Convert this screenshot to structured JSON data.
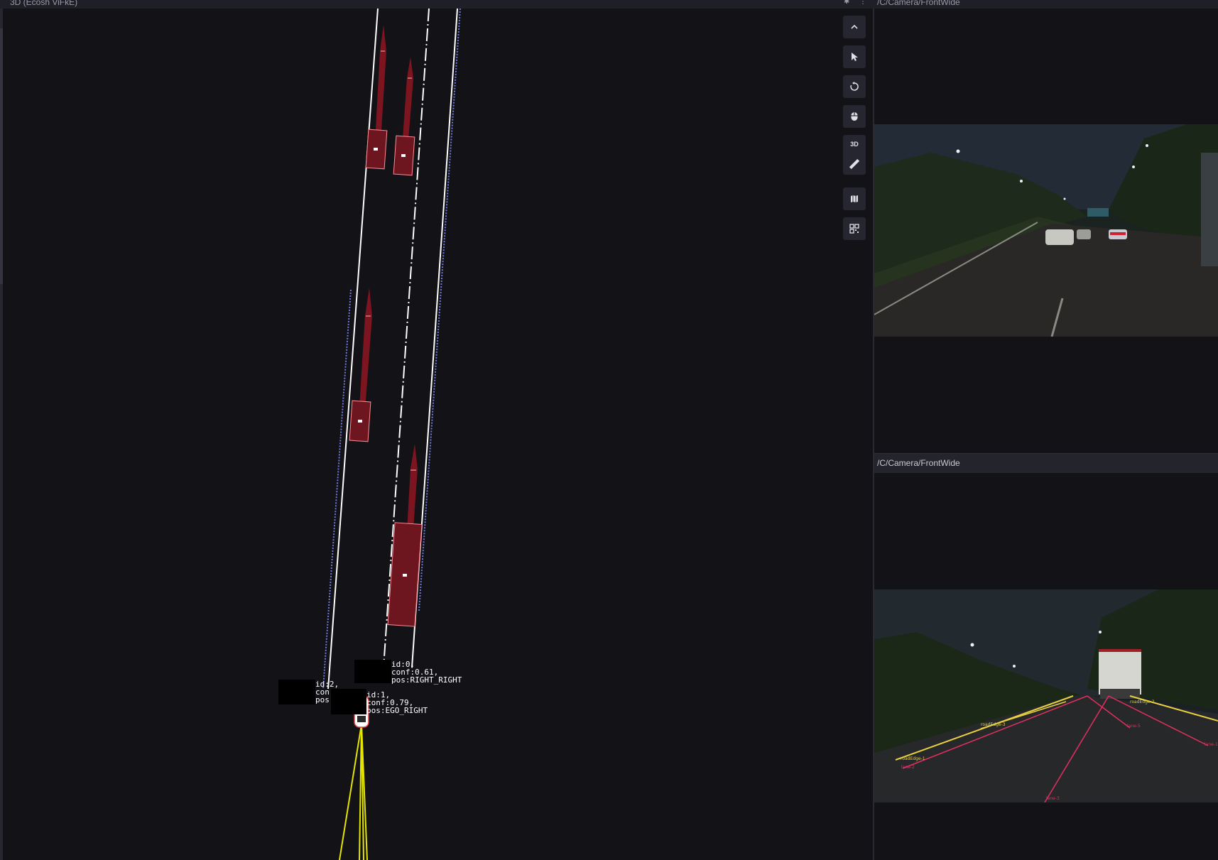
{
  "topbar": {
    "left_title": "3D (Ecosh ViFkE)",
    "right_title": "/C/Camera/FrontWide"
  },
  "scene": {
    "detections": [
      {
        "id_text": "id:0,",
        "conf_text": "conf:0.61,",
        "pos_text": "pos:RIGHT_RIGHT"
      },
      {
        "id_text": "id:1,",
        "conf_text": "conf:0.79,",
        "pos_text": "pos:EGO_RIGHT"
      },
      {
        "id_text": "id:2,",
        "conf_text": "con",
        "pos_text": "pos"
      }
    ],
    "colors": {
      "background": "#121217",
      "lane_line": "#ffffff",
      "lane_edge_blue": "#6f7bd8",
      "vehicle_fill": "#6e1620",
      "vehicle_stroke": "#ff8a95",
      "trajectory": "#e5e500",
      "velocity_arrow": "#8a1622"
    }
  },
  "toolbar": {
    "buttons": [
      {
        "name": "collapse-button",
        "icon": "chevron-up-icon"
      },
      {
        "name": "select-tool-button",
        "icon": "cursor-icon"
      },
      {
        "name": "rotate-view-button",
        "icon": "rotate-icon"
      },
      {
        "name": "mouse-mode-button",
        "icon": "mouse-icon"
      },
      {
        "name": "view-3d-button",
        "label": "3D",
        "icon": "ruler-icon"
      },
      {
        "name": "map-button",
        "icon": "map-icon"
      },
      {
        "name": "qr-button",
        "icon": "grid-icon"
      }
    ]
  },
  "camera_bottom": {
    "topic": "/C/Camera/FrontWide",
    "lane_labels": [
      "roadEdge-1",
      "roadEdge-3",
      "roadEdge-2",
      "lane-2",
      "lane-3",
      "lane-5",
      "lane-1"
    ]
  }
}
